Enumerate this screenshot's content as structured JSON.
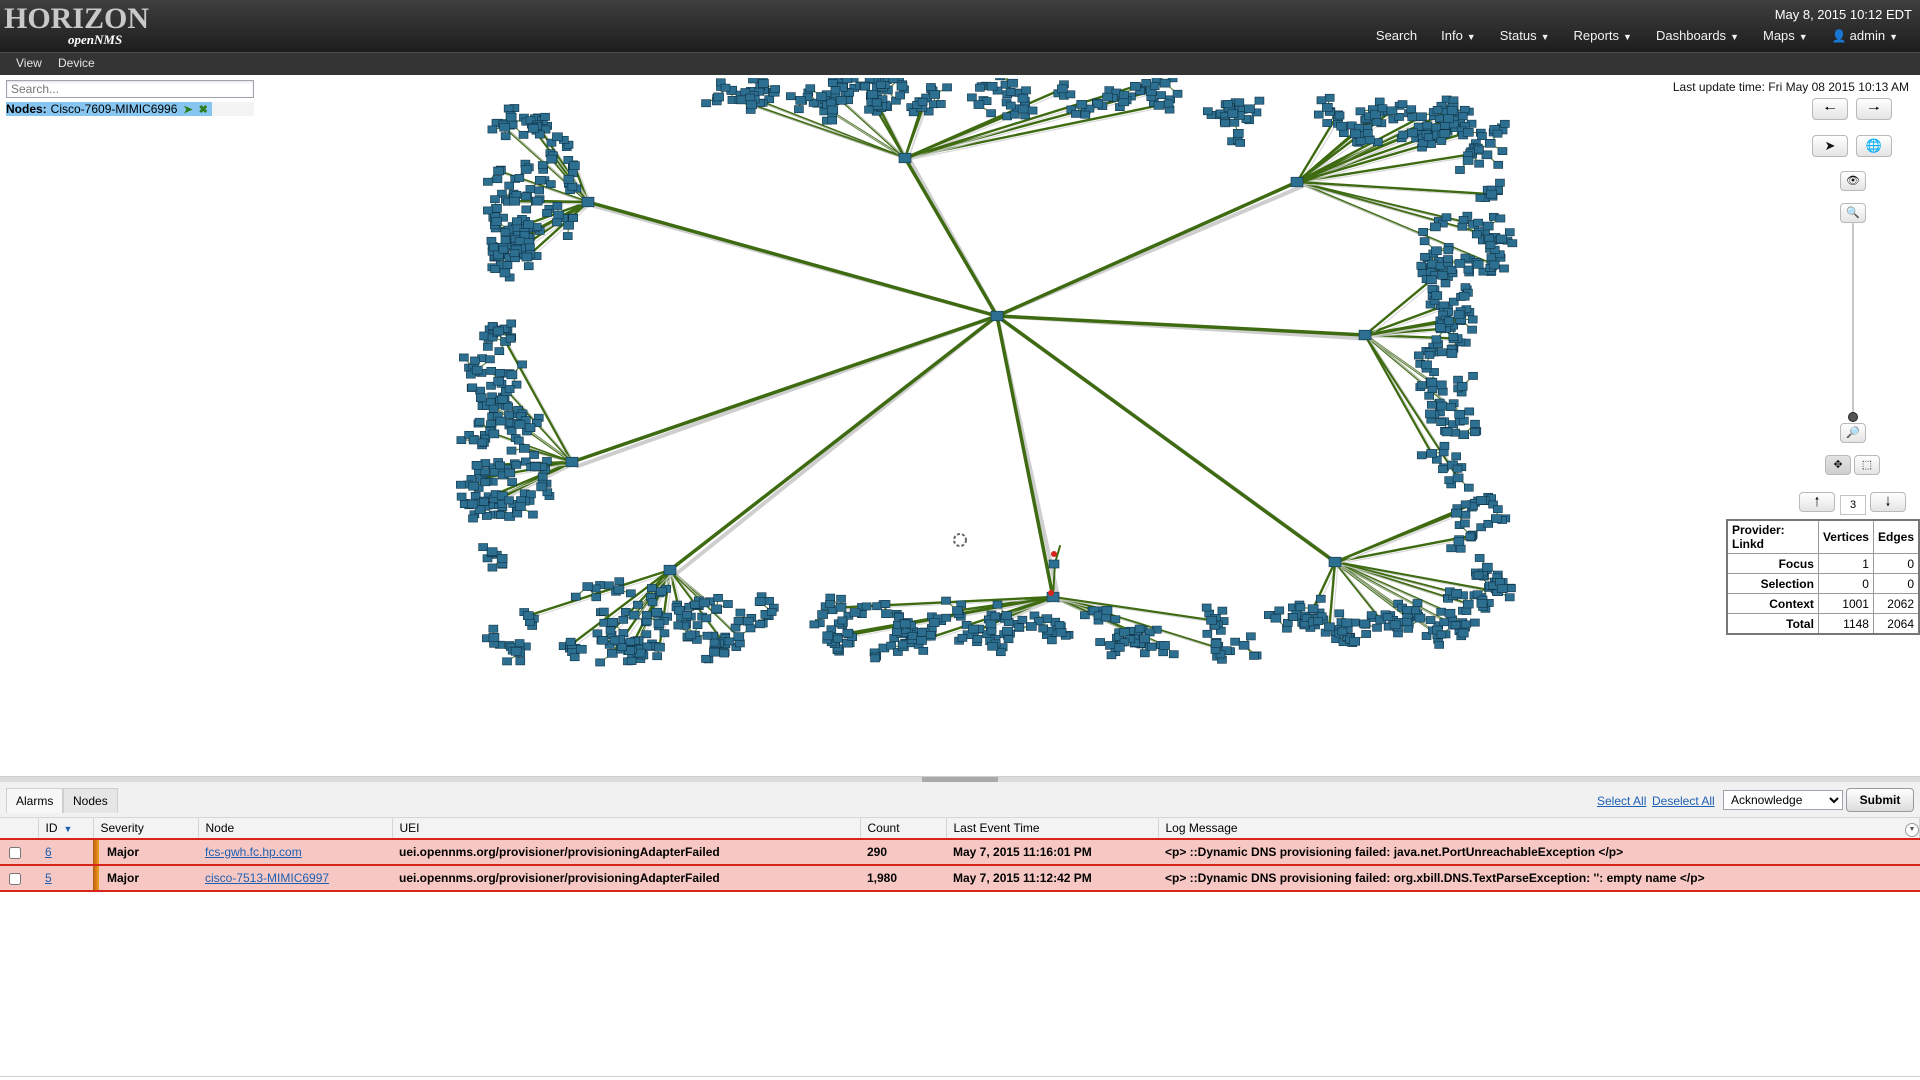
{
  "header": {
    "logo_text": "HORIZON",
    "logo_sub": "openNMS",
    "datetime": "May 8, 2015 10:12 EDT",
    "nav": [
      {
        "label": "Search",
        "has_caret": false
      },
      {
        "label": "Info",
        "has_caret": true
      },
      {
        "label": "Status",
        "has_caret": true
      },
      {
        "label": "Reports",
        "has_caret": true
      },
      {
        "label": "Dashboards",
        "has_caret": true
      },
      {
        "label": "Maps",
        "has_caret": true
      },
      {
        "label": "admin",
        "has_caret": true,
        "icon": "user-icon"
      }
    ]
  },
  "menubar": {
    "view": "View",
    "device": "Device"
  },
  "search": {
    "placeholder": "Search..."
  },
  "focus": {
    "label": "Nodes:",
    "value": "Cisco-7609-MIMIC6996",
    "icons": [
      "location-arrow-icon",
      "remove-icon"
    ]
  },
  "map": {
    "last_update": "Last update time: Fri May 08 2015 10:13 AM",
    "edge_color": "#3e6b11",
    "node_color": "#2d6f91",
    "alarm_color": "#d8251c"
  },
  "controls": {
    "semantic_zoom_level": "3",
    "buttons": [
      "arrow-left-icon",
      "arrow-right-icon",
      "location-arrow-icon",
      "globe-icon",
      "eye-icon",
      "zoom-in-icon",
      "zoom-out-icon",
      "pan-icon",
      "select-icon",
      "arrow-up-icon",
      "arrow-down-icon"
    ]
  },
  "provider": {
    "headers": [
      "Provider: Linkd",
      "Vertices",
      "Edges"
    ],
    "rows": [
      {
        "label": "Focus",
        "vertices": "1",
        "edges": "0"
      },
      {
        "label": "Selection",
        "vertices": "0",
        "edges": "0"
      },
      {
        "label": "Context",
        "vertices": "1001",
        "edges": "2062"
      },
      {
        "label": "Total",
        "vertices": "1148",
        "edges": "2064"
      }
    ]
  },
  "bottom": {
    "tabs": [
      "Alarms",
      "Nodes"
    ],
    "select_all": "Select All",
    "deselect_all": "Deselect All",
    "action": "Acknowledge",
    "action_options": [
      "Acknowledge"
    ],
    "submit": "Submit",
    "columns": [
      "ID",
      "Severity",
      "Node",
      "UEI",
      "Count",
      "Last Event Time",
      "Log Message"
    ],
    "alarms": [
      {
        "id": "6",
        "severity": "Major",
        "node": "fcs-gwh.fc.hp.com",
        "uei": "uei.opennms.org/provisioner/provisioningAdapterFailed",
        "count": "290",
        "last_event": "May 7, 2015 11:16:01 PM",
        "log": "<p> ::Dynamic DNS provisioning failed: java.net.PortUnreachableException </p>"
      },
      {
        "id": "5",
        "severity": "Major",
        "node": "cisco-7513-MIMIC6997",
        "uei": "uei.opennms.org/provisioner/provisioningAdapterFailed",
        "count": "1,980",
        "last_event": "May 7, 2015 11:12:42 PM",
        "log": "<p> ::Dynamic DNS provisioning failed: org.xbill.DNS.TextParseException: '': empty name </p>"
      }
    ]
  }
}
